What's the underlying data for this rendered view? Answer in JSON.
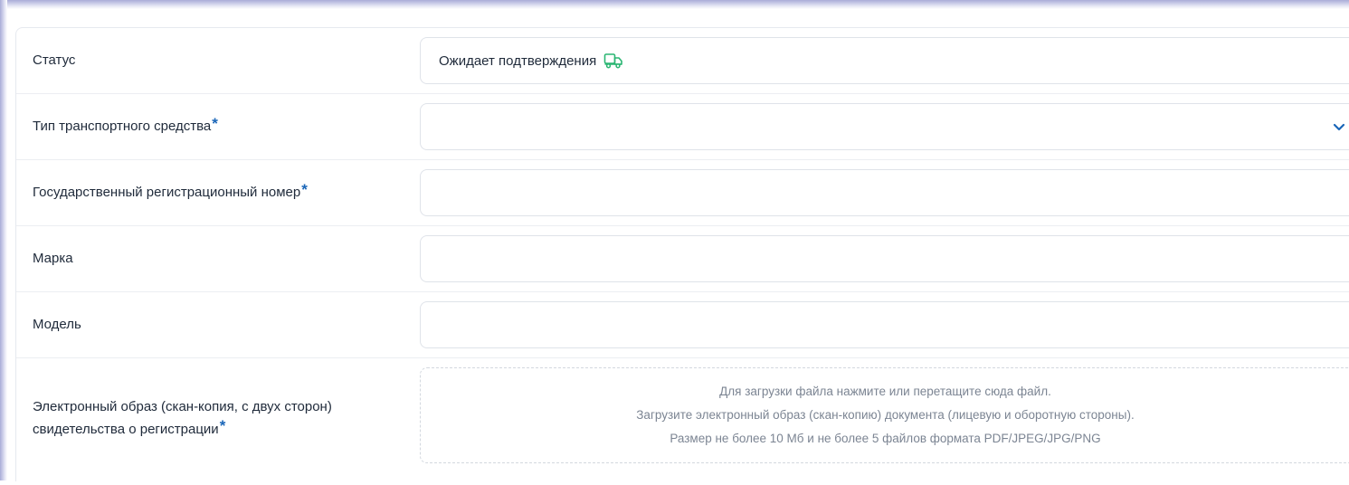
{
  "form": {
    "status": {
      "label": "Статус",
      "value": "Ожидает подтверждения",
      "icon": "truck-icon",
      "icon_color": "#2bb673"
    },
    "vehicle_type": {
      "label": "Тип транспортного средства",
      "required_mark": "*",
      "value": ""
    },
    "reg_number": {
      "label": "Государственный регистрационный номер",
      "required_mark": "*",
      "value": ""
    },
    "brand": {
      "label": "Марка",
      "value": ""
    },
    "model": {
      "label": "Модель",
      "value": ""
    },
    "certificate": {
      "label_line1": "Электронный образ (скан-копия, с двух сторон)",
      "label_line2": "свидетельства о регистрации",
      "required_mark": "*",
      "upload_line1": "Для загрузки файла нажмите или перетащите сюда файл.",
      "upload_line2": "Загрузите электронный образ (скан-копию) документа (лицевую и оборотную стороны).",
      "upload_line3": "Размер не более 10 Мб и не более 5 файлов формата PDF/JPEG/JPG/PNG"
    }
  },
  "colors": {
    "accent": "#1a66b8",
    "border": "#dfe3e9",
    "muted_text": "#7c8593"
  }
}
